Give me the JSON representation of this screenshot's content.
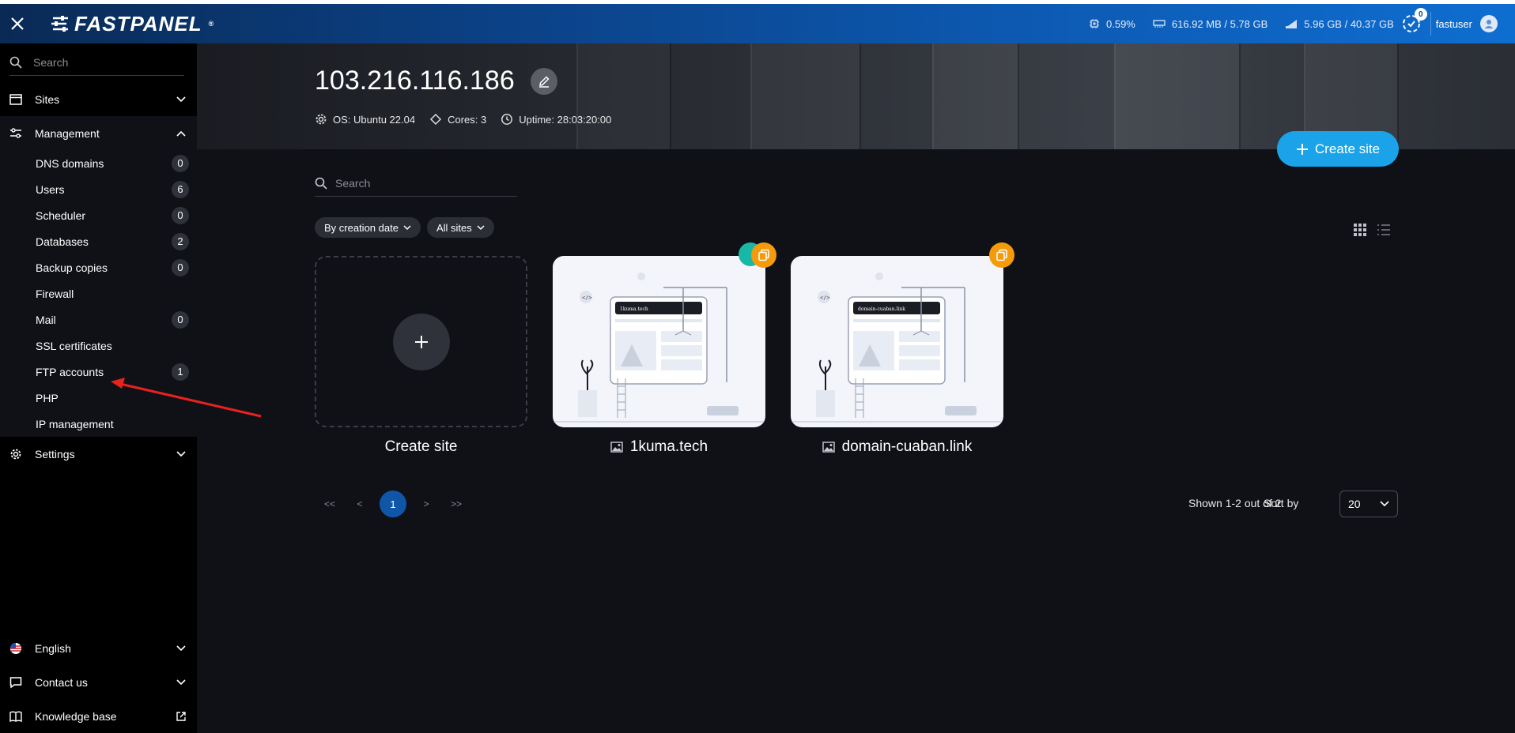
{
  "header": {
    "logo_text": "FASTPANEL",
    "logo_mark": "®",
    "cpu": "0.59%",
    "ram": "616.92 MB / 5.78 GB",
    "disk": "5.96 GB / 40.37 GB",
    "notifications": "0",
    "username": "fastuser"
  },
  "sidebar": {
    "search_placeholder": "Search",
    "sites_label": "Sites",
    "management_label": "Management",
    "management_items": [
      {
        "label": "DNS domains",
        "count": "0"
      },
      {
        "label": "Users",
        "count": "6"
      },
      {
        "label": "Scheduler",
        "count": "0"
      },
      {
        "label": "Databases",
        "count": "2"
      },
      {
        "label": "Backup copies",
        "count": "0"
      },
      {
        "label": "Firewall",
        "count": ""
      },
      {
        "label": "Mail",
        "count": "0"
      },
      {
        "label": "SSL certificates",
        "count": ""
      },
      {
        "label": "FTP accounts",
        "count": "1"
      },
      {
        "label": "PHP",
        "count": ""
      },
      {
        "label": "IP management",
        "count": ""
      }
    ],
    "settings_label": "Settings",
    "language_label": "English",
    "contact_label": "Contact us",
    "kb_label": "Knowledge base"
  },
  "server": {
    "ip": "103.216.116.186",
    "os": "OS: Ubuntu 22.04",
    "cores": "Cores: 3",
    "uptime": "Uptime: 28:03:20:00"
  },
  "main": {
    "create_site_button": "Create site",
    "search_placeholder": "Search",
    "filter_sort": "By creation date",
    "filter_sites": "All sites",
    "cards": [
      {
        "label": "Create site"
      },
      {
        "label": "1kuma.tech",
        "preview_text": "1kuma.tech"
      },
      {
        "label": "domain-cuaban.link",
        "preview_text": "domain-cuaban.link"
      }
    ],
    "pager": {
      "first": "<<",
      "prev": "<",
      "current": "1",
      "next": ">",
      "last": ">>"
    },
    "shown_text": "Shown 1-2 out of 2",
    "sort_by_label": "Sort by",
    "per_page": "20"
  },
  "colors": {
    "accent": "#1aa3e8",
    "orange_badge": "#f59b0b",
    "teal_badge": "#17b8a6",
    "annotation_arrow": "#e8221d"
  }
}
